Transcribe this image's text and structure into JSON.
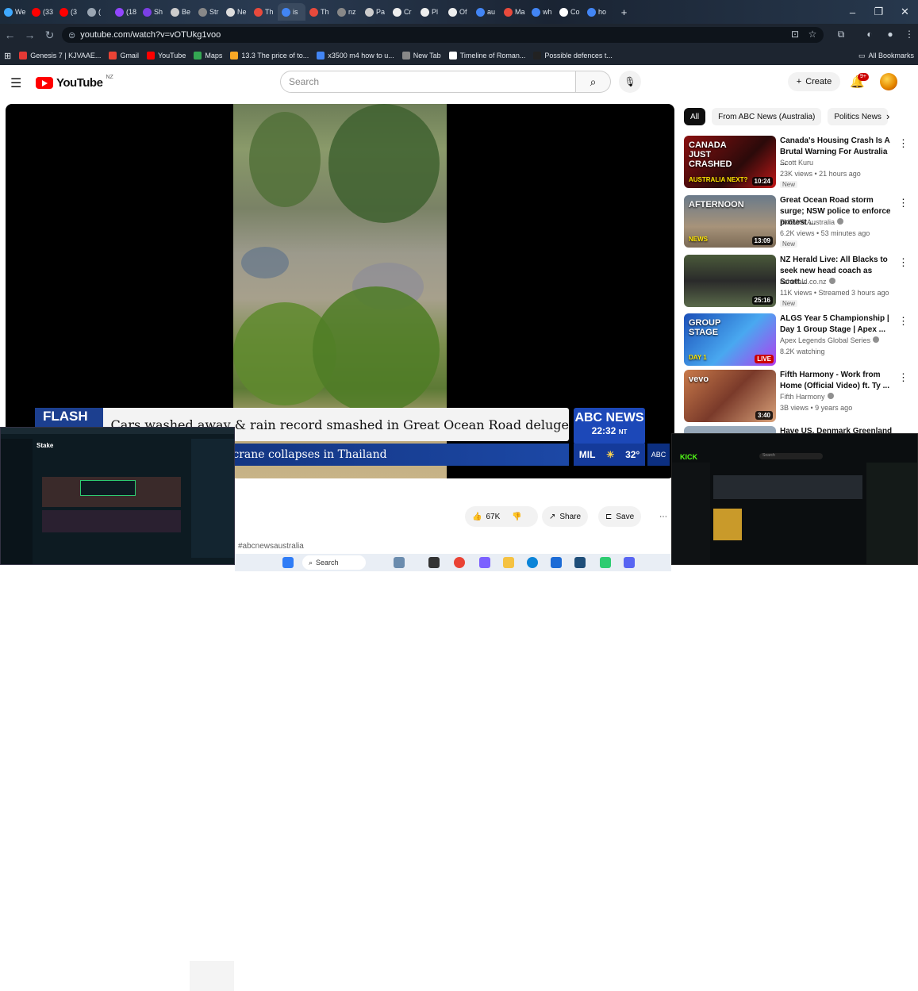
{
  "browser": {
    "tabs": [
      {
        "label": "We",
        "color": "#3fa9ff",
        "icon": "plus-icon"
      },
      {
        "label": "(33",
        "color": "#ff0000",
        "icon": "youtube-icon"
      },
      {
        "label": "(3",
        "color": "#ff0000",
        "icon": "youtube-icon"
      },
      {
        "label": "(",
        "color": "#9aa6b3",
        "icon": "audio-icon"
      },
      {
        "label": "(18",
        "color": "#9146ff",
        "icon": "twitch-icon"
      },
      {
        "label": "Sh",
        "color": "#7b3fe4",
        "icon": "app-icon"
      },
      {
        "label": "Be",
        "color": "#cccccc",
        "icon": "page-icon"
      },
      {
        "label": "Str",
        "color": "#888888",
        "icon": "globe-icon"
      },
      {
        "label": "Ne",
        "color": "#dddddd",
        "icon": "page-icon"
      },
      {
        "label": "Th",
        "color": "#e84a3c",
        "icon": "page-icon"
      },
      {
        "label": "is",
        "color": "#4285f4",
        "icon": "google-icon"
      },
      {
        "label": "Th",
        "color": "#e84a3c",
        "icon": "page-icon"
      },
      {
        "label": "nz",
        "color": "#888888",
        "icon": "globe-icon"
      },
      {
        "label": "Pa",
        "color": "#cccccc",
        "icon": "page-icon"
      },
      {
        "label": "Cr",
        "color": "#eeeeee",
        "icon": "ai-icon"
      },
      {
        "label": "Pl",
        "color": "#eeeeee",
        "icon": "ai-icon"
      },
      {
        "label": "Of",
        "color": "#eeeeee",
        "icon": "ai-icon"
      },
      {
        "label": "au",
        "color": "#4285f4",
        "icon": "google-icon"
      },
      {
        "label": "Ma",
        "color": "#e84a3c",
        "icon": "page-icon"
      },
      {
        "label": "wh",
        "color": "#4285f4",
        "icon": "google-icon"
      },
      {
        "label": "Co",
        "color": "#ffffff",
        "icon": "wiki-icon"
      },
      {
        "label": "ho",
        "color": "#4285f4",
        "icon": "google-icon"
      }
    ],
    "new_tab": "+",
    "window_controls": {
      "minimize": "–",
      "restore": "❐",
      "close": "✕"
    },
    "url": "youtube.com/watch?v=vOTUkg1voo",
    "bookmarks": [
      {
        "label": "Genesis 7 | KJVAAE...",
        "color": "#e53935"
      },
      {
        "label": "Gmail",
        "color": "#ea4335"
      },
      {
        "label": "YouTube",
        "color": "#ff0000"
      },
      {
        "label": "Maps",
        "color": "#34a853"
      },
      {
        "label": "13.3 The price of to...",
        "color": "#f9a825"
      },
      {
        "label": "x3500 m4 how to u...",
        "color": "#4285f4"
      },
      {
        "label": "New Tab",
        "color": "#888888"
      },
      {
        "label": "Timeline of Roman...",
        "color": "#ffffff"
      },
      {
        "label": "Possible defences t...",
        "color": "#222222"
      }
    ],
    "all_bookmarks": "All Bookmarks"
  },
  "youtube": {
    "logo_text": "YouTube",
    "country": "NZ",
    "search_placeholder": "Search",
    "create_label": "Create",
    "notif_count": "9+",
    "video": {
      "flash_label": "FLASH FLOOD",
      "headline": "Cars washed away & rain record smashed in Great Ocean Road deluge",
      "ticker": "ion crane collapses in Thailand",
      "channel_brand": "ABC NEWS",
      "time": "22:32",
      "tz": "NT",
      "weather_city": "MIL",
      "temp": "32°"
    },
    "chips": [
      "All",
      "From ABC News (Australia)",
      "Politics News"
    ],
    "recommendations": [
      {
        "title": "Canada's Housing Crash Is A Brutal Warning For Australia ...",
        "channel": "Scott Kuru",
        "verified": false,
        "meta": "23K views • 21 hours ago",
        "badge": "New",
        "duration": "10:24",
        "thumb_text": "CANADA JUST CRASHED",
        "thumb_sub": "AUSTRALIA NEXT?"
      },
      {
        "title": "Great Ocean Road storm surge; NSW police to enforce protest ...",
        "channel": "7NEWS Australia",
        "verified": true,
        "meta": "6.2K views • 53 minutes ago",
        "badge": "New",
        "duration": "13:09",
        "thumb_text": "AFTERNOON",
        "thumb_sub": "NEWS"
      },
      {
        "title": "NZ Herald Live: All Blacks to seek new head coach as Scott...",
        "channel": "nzherald.co.nz",
        "verified": true,
        "meta": "11K views • Streamed 3 hours ago",
        "badge": "New",
        "duration": "25:16",
        "thumb_text": "",
        "thumb_sub": ""
      },
      {
        "title": "ALGS Year 5 Championship | Day 1 Group Stage | Apex ...",
        "channel": "Apex Legends Global Series",
        "verified": true,
        "meta": "8.2K watching",
        "badge": "",
        "duration": "LIVE",
        "thumb_text": "GROUP STAGE",
        "thumb_sub": "DAY 1"
      },
      {
        "title": "Fifth Harmony - Work from Home (Official Video) ft. Ty ...",
        "channel": "Fifth Harmony",
        "verified": true,
        "meta": "3B views • 9 years ago",
        "badge": "",
        "duration": "3:40",
        "thumb_text": "vevo",
        "thumb_sub": ""
      },
      {
        "title": "Have US, Denmark Greenland ...",
        "channel": "",
        "verified": false,
        "meta": "",
        "badge": "",
        "duration": "",
        "thumb_text": "",
        "thumb_sub": ""
      }
    ],
    "actions": {
      "likes": "67K",
      "share": "Share",
      "save": "Save",
      "more": "⋯"
    },
    "hashtag": "#abcnewsaustralia"
  },
  "taskbar": {
    "search_label": "Search"
  },
  "overlays": {
    "left_label": "Stake",
    "right_label": "KICK",
    "kick_search": "Search"
  }
}
